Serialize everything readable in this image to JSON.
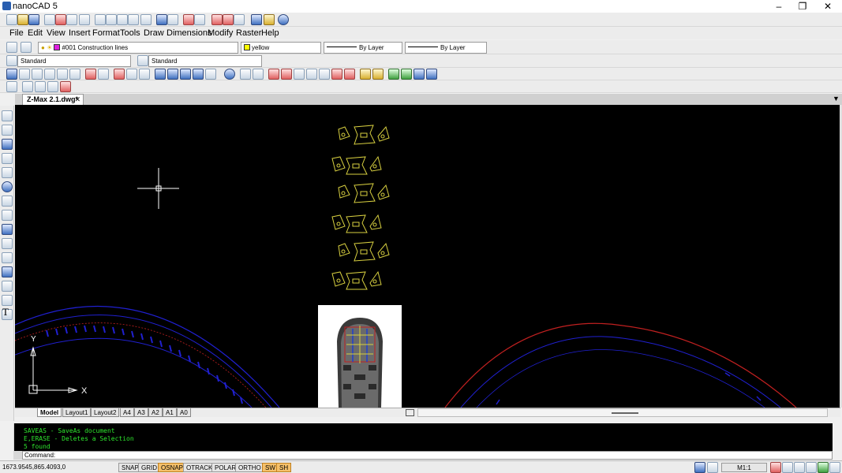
{
  "window": {
    "title": "nanoCAD 5"
  },
  "menus": [
    "File",
    "Edit",
    "View",
    "Insert",
    "Format",
    "Tools",
    "Draw",
    "Dimensions",
    "Modify",
    "Raster",
    "Help"
  ],
  "properties": {
    "layer": "#001 Construction lines",
    "color": "yellow",
    "linetype": "By Layer",
    "lineweight": "By Layer",
    "text_style": "Standard",
    "dim_style": "Standard"
  },
  "document": {
    "tab": "Z-Max 2.1.dwg*"
  },
  "layout_tabs": [
    "Model",
    "Layout1",
    "Layout2",
    "A4",
    "A3",
    "A2",
    "A1",
    "A0"
  ],
  "command_history": [
    "SAVEAS - SaveAs document",
    "E,ERASE - Deletes a Selection",
    "5 found"
  ],
  "command_prompt": "Command:",
  "status": {
    "coords": "1673.9545,865.4093,0",
    "toggles": [
      {
        "label": "SNAP",
        "on": false
      },
      {
        "label": "GRID",
        "on": false
      },
      {
        "label": "OSNAP",
        "on": true
      },
      {
        "label": "OTRACK",
        "on": false
      },
      {
        "label": "POLAR",
        "on": false
      },
      {
        "label": "ORTHO",
        "on": false
      },
      {
        "label": "SW",
        "on": true
      },
      {
        "label": "SH",
        "on": true
      }
    ],
    "scale": "M1:1"
  },
  "ucs": {
    "y_label": "Y",
    "x_label": "X"
  },
  "colors": {
    "canvas": "#000000",
    "drawing_yellow": "#d8d040",
    "arc_blue": "#2020d0",
    "arc_red": "#c02020",
    "cmd_text": "#2ee62e"
  }
}
